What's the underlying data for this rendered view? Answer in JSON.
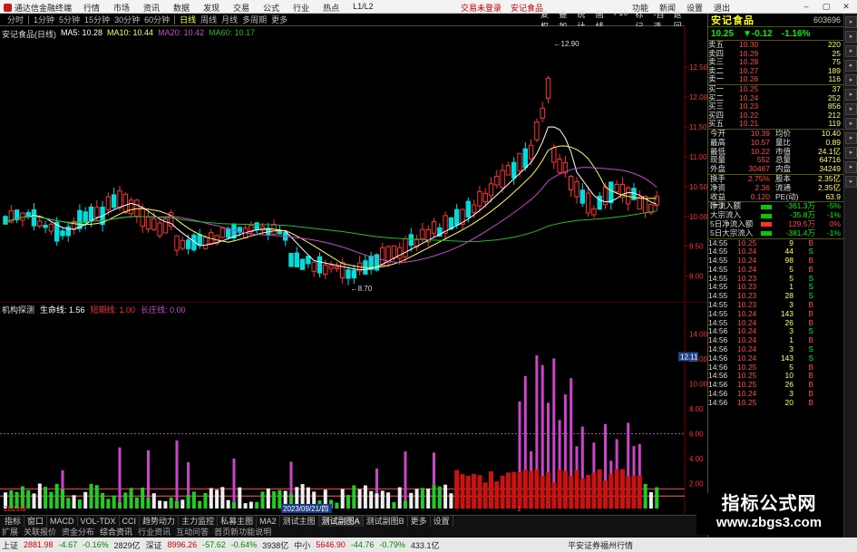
{
  "titlebar": {
    "app": "通达信金融终端",
    "menu": [
      "行情",
      "市场",
      "资讯",
      "数据",
      "发现",
      "交易",
      "公式",
      "行业",
      "热点",
      "L1/L2"
    ],
    "center": [
      "交易未登录",
      "安记食品"
    ],
    "right": [
      "功能",
      "新闻",
      "设置",
      "退出"
    ]
  },
  "toolbar": {
    "periods": [
      "分时",
      "1分钟",
      "5分钟",
      "15分钟",
      "30分钟",
      "60分钟",
      "日线",
      "周线",
      "月线",
      "多周期",
      "更多"
    ],
    "active": "日线",
    "right": [
      "复权",
      "叠加",
      "统计",
      "画线",
      "F10",
      "标记",
      "-自选",
      "返回"
    ]
  },
  "main": {
    "name": "安记食品(日线)",
    "ma": [
      "MA5: 10.28",
      "MA10: 10.44",
      "MA20: 10.42",
      "MA60: 10.17"
    ],
    "yticks": [
      "12.50",
      "12.00",
      "11.50",
      "11.00",
      "10.50",
      "10.00",
      "9.50",
      "9.00"
    ],
    "high_label": "12.90",
    "low_label": "8.70",
    "colors": {
      "up": "#ff3030",
      "down": "#00dddd",
      "ma5": "#ffffff",
      "ma10": "#ffff55",
      "ma20": "#cc44cc",
      "ma60": "#22bb22"
    }
  },
  "sub": {
    "name": "机构探测",
    "lines": [
      "生命线: 1.56",
      "短期线: 1.00",
      "长庄线: 0.00"
    ],
    "yticks": [
      "14.00",
      "12.00",
      "10.00",
      "8.00",
      "6.00",
      "4.00",
      "2.00"
    ],
    "mark": "12.11",
    "xlabels": [
      "2023年",
      "2023/09/21/四",
      "1"
    ]
  },
  "tabs": [
    "指标",
    "窗口",
    "MACD",
    "VOL-TDX",
    "CCI",
    "趋势动力",
    "主力监控",
    "私募主图",
    "MA2",
    "测试主图",
    "测试副图A",
    "测试副图B",
    "更多",
    "设置"
  ],
  "scroll": [
    "扩展",
    "关联报价",
    "资金分布",
    "综合资讯",
    "行业资讯",
    "互动问答",
    "首页新功能说明"
  ],
  "quote": {
    "name": "安记食品",
    "code": "603696",
    "price": "10.25",
    "change": "▼-0.12",
    "pct": "-1.16%",
    "asks": [
      [
        "卖五",
        "10.30",
        "220"
      ],
      [
        "卖四",
        "10.29",
        "25"
      ],
      [
        "卖三",
        "10.28",
        "75"
      ],
      [
        "卖二",
        "10.27",
        "189"
      ],
      [
        "卖一",
        "10.26",
        "116"
      ]
    ],
    "bids": [
      [
        "买一",
        "10.25",
        "37"
      ],
      [
        "买二",
        "10.24",
        "252"
      ],
      [
        "买三",
        "10.23",
        "856"
      ],
      [
        "买四",
        "10.22",
        "212"
      ],
      [
        "买五",
        "10.21",
        "119"
      ]
    ],
    "stats": [
      [
        "今开",
        "10.39",
        "均价",
        "10.40"
      ],
      [
        "最高",
        "10.57",
        "量比",
        "0.89"
      ],
      [
        "最低",
        "10.22",
        "市值",
        "24.1亿"
      ],
      [
        "现量",
        "552",
        "总量",
        "64716"
      ],
      [
        "外盘",
        "30467",
        "内盘",
        "34249"
      ]
    ],
    "stats2": [
      [
        "换手",
        "2.75%",
        "股本",
        "2.35亿"
      ],
      [
        "净资",
        "2.36",
        "流通",
        "2.35亿"
      ],
      [
        "收益(一)",
        "0.120",
        "PE(动)",
        "63.9"
      ]
    ],
    "flows": [
      [
        "净流入额",
        "-361.3万",
        "-5%"
      ],
      [
        "大宗流入",
        "-35.8万",
        "-1%"
      ],
      [
        "5日净流入额",
        "129.5万",
        "0%"
      ],
      [
        "5日大宗流入",
        "-381.4万",
        "-1%"
      ]
    ],
    "ticks": [
      [
        "14:55",
        "10.25",
        "9",
        "B"
      ],
      [
        "14:55",
        "10.24",
        "44",
        "S"
      ],
      [
        "14:55",
        "10.24",
        "98",
        "B"
      ],
      [
        "14:55",
        "10.24",
        "5",
        "B"
      ],
      [
        "14:55",
        "10.23",
        "5",
        "S"
      ],
      [
        "14:55",
        "10.23",
        "1",
        "S"
      ],
      [
        "14:55",
        "10.23",
        "28",
        "S"
      ],
      [
        "14:55",
        "10.23",
        "3",
        "B"
      ],
      [
        "14:55",
        "10.24",
        "143",
        "B"
      ],
      [
        "14:55",
        "10.24",
        "26",
        "B"
      ],
      [
        "14:56",
        "10.24",
        "3",
        "S"
      ],
      [
        "14:56",
        "10.24",
        "1",
        "B"
      ],
      [
        "14:56",
        "10.24",
        "3",
        "S"
      ],
      [
        "14:56",
        "10.24",
        "143",
        "S"
      ],
      [
        "14:56",
        "10.25",
        "5",
        "B"
      ],
      [
        "14:56",
        "10.25",
        "10",
        "B"
      ],
      [
        "14:56",
        "10.25",
        "26",
        "B"
      ],
      [
        "14:56",
        "10.24",
        "3",
        "B"
      ],
      [
        "14:56",
        "10.25",
        "20",
        "B"
      ]
    ]
  },
  "status": {
    "items": [
      [
        "上证",
        "2881.98",
        "-4.67",
        "-0.16%",
        "2829亿"
      ],
      [
        "深证",
        "8996.26",
        "-57.62",
        "-0.64%",
        "3938亿"
      ],
      [
        "中小",
        "5646.90",
        "-44.76",
        "-0.79%",
        "433.1亿"
      ]
    ],
    "right": "平安证券福州行情"
  },
  "watermark": {
    "line1": "指标公式网",
    "line2": "www.zbgs3.com"
  }
}
